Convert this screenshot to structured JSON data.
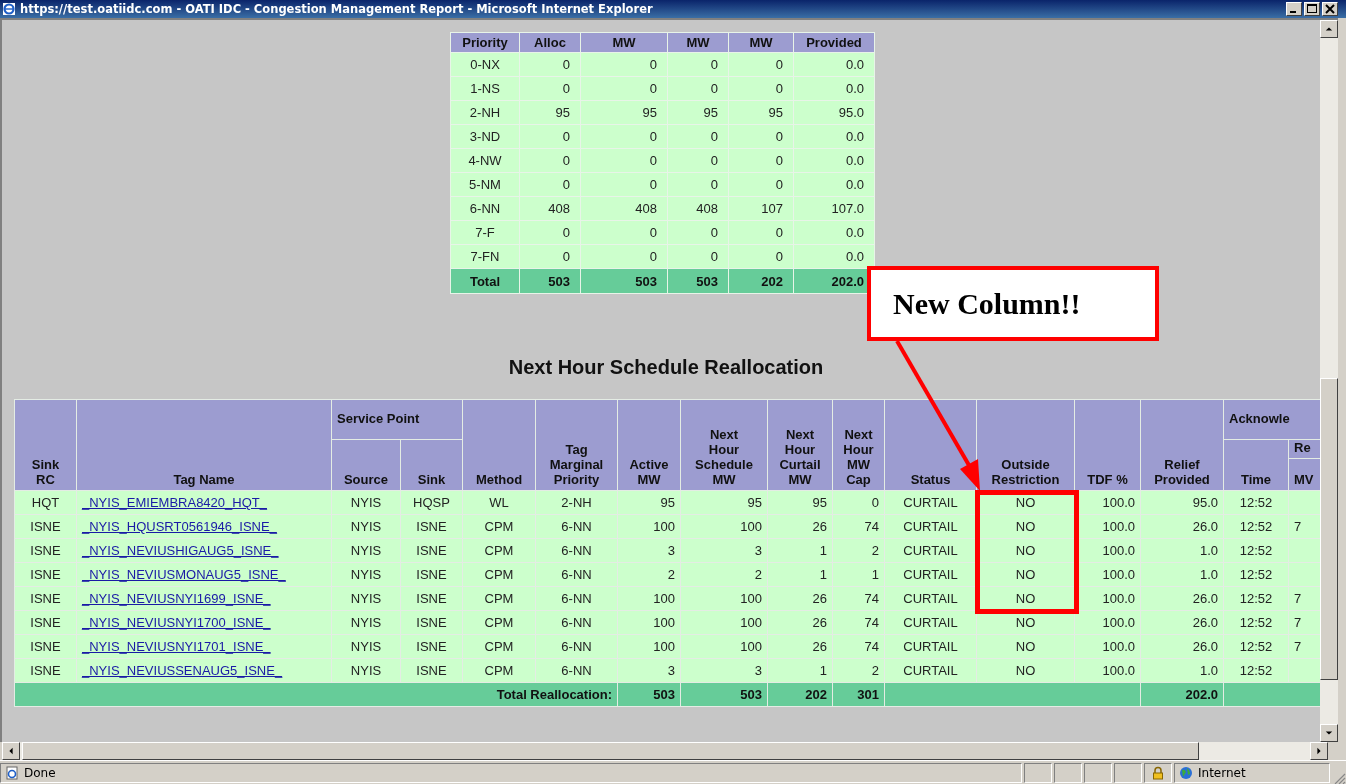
{
  "window": {
    "title": "https://test.oatiidc.com - OATI IDC - Congestion Management Report - Microsoft Internet Explorer"
  },
  "priority_table": {
    "columns": [
      "Priority",
      "Alloc",
      "MW",
      "MW",
      "MW",
      "Provided"
    ],
    "rows": [
      [
        "0-NX",
        "0",
        "0",
        "0",
        "0",
        "0.0"
      ],
      [
        "1-NS",
        "0",
        "0",
        "0",
        "0",
        "0.0"
      ],
      [
        "2-NH",
        "95",
        "95",
        "95",
        "95",
        "95.0"
      ],
      [
        "3-ND",
        "0",
        "0",
        "0",
        "0",
        "0.0"
      ],
      [
        "4-NW",
        "0",
        "0",
        "0",
        "0",
        "0.0"
      ],
      [
        "5-NM",
        "0",
        "0",
        "0",
        "0",
        "0.0"
      ],
      [
        "6-NN",
        "408",
        "408",
        "408",
        "107",
        "107.0"
      ],
      [
        "7-F",
        "0",
        "0",
        "0",
        "0",
        "0.0"
      ],
      [
        "7-FN",
        "0",
        "0",
        "0",
        "0",
        "0.0"
      ]
    ],
    "total": [
      "Total",
      "503",
      "503",
      "503",
      "202",
      "202.0"
    ]
  },
  "section_title": "Next Hour Schedule Reallocation",
  "reallocation_table": {
    "header_rows": [
      [
        {
          "text": "Sink\nRC",
          "rowspan": 3
        },
        {
          "text": "Tag Name",
          "rowspan": 3
        },
        {
          "text": "Service Point",
          "colspan": 2
        },
        {
          "text": "Method",
          "rowspan": 3
        },
        {
          "text": "Tag\nMarginal\nPriority",
          "rowspan": 3
        },
        {
          "text": "Active\nMW",
          "rowspan": 3
        },
        {
          "text": "Next\nHour\nSchedule\nMW",
          "rowspan": 3
        },
        {
          "text": "Next\nHour\nCurtail\nMW",
          "rowspan": 3
        },
        {
          "text": "Next\nHour\nMW\nCap",
          "rowspan": 3
        },
        {
          "text": "Status",
          "rowspan": 3
        },
        {
          "text": "Outside\nRestriction",
          "rowspan": 3
        },
        {
          "text": "TDF %",
          "rowspan": 3
        },
        {
          "text": "Relief\nProvided",
          "rowspan": 3
        },
        {
          "text": "Acknowle",
          "colspan": 2
        }
      ],
      [
        {
          "text": "Source",
          "rowspan": 2
        },
        {
          "text": "Sink",
          "rowspan": 2
        },
        {
          "text": "Time",
          "rowspan": 2
        },
        {
          "text": "Re"
        }
      ],
      [
        {
          "text": "MV"
        }
      ]
    ],
    "rows": [
      {
        "sink_rc": "HQT",
        "tag_name": "_NYIS_EMIEMBRA8420_HQT_",
        "source": "NYIS",
        "sink": "HQSP",
        "method": "WL",
        "priority": "2-NH",
        "active_mw": "95",
        "schedule_mw": "95",
        "curtail_mw": "95",
        "mw_cap": "0",
        "status": "CURTAIL",
        "outside_restriction": "NO",
        "tdf": "100.0",
        "relief": "95.0",
        "time": "12:52"
      },
      {
        "sink_rc": "ISNE",
        "tag_name": "_NYIS_HQUSRT0561946_ISNE_",
        "source": "NYIS",
        "sink": "ISNE",
        "method": "CPM",
        "priority": "6-NN",
        "active_mw": "100",
        "schedule_mw": "100",
        "curtail_mw": "26",
        "mw_cap": "74",
        "status": "CURTAIL",
        "outside_restriction": "NO",
        "tdf": "100.0",
        "relief": "26.0",
        "time": "12:52",
        "column_16": "7"
      },
      {
        "sink_rc": "ISNE",
        "tag_name": "_NYIS_NEVIUSHIGAUG5_ISNE_",
        "source": "NYIS",
        "sink": "ISNE",
        "method": "CPM",
        "priority": "6-NN",
        "active_mw": "3",
        "schedule_mw": "3",
        "curtail_mw": "1",
        "mw_cap": "2",
        "status": "CURTAIL",
        "outside_restriction": "NO",
        "tdf": "100.0",
        "relief": "1.0",
        "time": "12:52"
      },
      {
        "sink_rc": "ISNE",
        "tag_name": "_NYIS_NEVIUSMONAUG5_ISNE_",
        "source": "NYIS",
        "sink": "ISNE",
        "method": "CPM",
        "priority": "6-NN",
        "active_mw": "2",
        "schedule_mw": "2",
        "curtail_mw": "1",
        "mw_cap": "1",
        "status": "CURTAIL",
        "outside_restriction": "NO",
        "tdf": "100.0",
        "relief": "1.0",
        "time": "12:52"
      },
      {
        "sink_rc": "ISNE",
        "tag_name": "_NYIS_NEVIUSNYI1699_ISNE_",
        "source": "NYIS",
        "sink": "ISNE",
        "method": "CPM",
        "priority": "6-NN",
        "active_mw": "100",
        "schedule_mw": "100",
        "curtail_mw": "26",
        "mw_cap": "74",
        "status": "CURTAIL",
        "outside_restriction": "NO",
        "tdf": "100.0",
        "relief": "26.0",
        "time": "12:52",
        "column_16": "7"
      },
      {
        "sink_rc": "ISNE",
        "tag_name": "_NYIS_NEVIUSNYI1700_ISNE_",
        "source": "NYIS",
        "sink": "ISNE",
        "method": "CPM",
        "priority": "6-NN",
        "active_mw": "100",
        "schedule_mw": "100",
        "curtail_mw": "26",
        "mw_cap": "74",
        "status": "CURTAIL",
        "outside_restriction": "NO",
        "tdf": "100.0",
        "relief": "26.0",
        "time": "12:52",
        "column_16": "7"
      },
      {
        "sink_rc": "ISNE",
        "tag_name": "_NYIS_NEVIUSNYI1701_ISNE_",
        "source": "NYIS",
        "sink": "ISNE",
        "method": "CPM",
        "priority": "6-NN",
        "active_mw": "100",
        "schedule_mw": "100",
        "curtail_mw": "26",
        "mw_cap": "74",
        "status": "CURTAIL",
        "outside_restriction": "NO",
        "tdf": "100.0",
        "relief": "26.0",
        "time": "12:52",
        "column_16": "7"
      },
      {
        "sink_rc": "ISNE",
        "tag_name": "_NYIS_NEVIUSSENAUG5_ISNE_",
        "source": "NYIS",
        "sink": "ISNE",
        "method": "CPM",
        "priority": "6-NN",
        "active_mw": "3",
        "schedule_mw": "3",
        "curtail_mw": "1",
        "mw_cap": "2",
        "status": "CURTAIL",
        "outside_restriction": "NO",
        "tdf": "100.0",
        "relief": "1.0",
        "time": "12:52"
      }
    ],
    "total": {
      "label": "Total Reallocation:",
      "active_mw": "503",
      "schedule_mw": "503",
      "curtail_mw": "202",
      "mw_cap": "301",
      "relief": "202.0"
    }
  },
  "annotation": {
    "label": "New Column!!"
  },
  "status_bar": {
    "text": "Done",
    "zone": "Internet"
  }
}
